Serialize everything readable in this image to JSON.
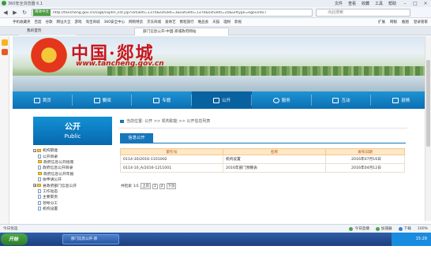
{
  "browser": {
    "window_title": "360安全浏览器 6.1",
    "menu": [
      "文件",
      "查看",
      "收藏",
      "工具",
      "帮助"
    ],
    "url_badge": "简体中文",
    "url": "http://tancheng.gov.cn/sxgk/sxjdm_list.jsp?sxfuletl=1370&sxfulet=3&sxfuletl=1370&sxfuletl=20&urltype=egovinfo.l",
    "search_placeholder": "点此搜索",
    "bookmarks": [
      "手机收藏夹",
      "百度",
      "谷歌",
      "网址大全",
      "游戏",
      "淘宝商城",
      "360安全中心",
      "网购特卖",
      "京东商城",
      "爱奇艺",
      "携程旅行",
      "唯品会",
      "天猫",
      "理财",
      "影视"
    ],
    "bookbar_right": [
      "扩展",
      "网银",
      "截图",
      "登录管家"
    ],
    "tabs": [
      "我的首页",
      "部门信息公开-中国·郯城政府网站"
    ]
  },
  "site": {
    "brand": "中国·郯城",
    "domain": "www.tancheng.gov.cn",
    "nav": [
      "首页",
      "要闻",
      "专题",
      "公开",
      "服务",
      "互动",
      "县情"
    ],
    "active_nav": 3
  },
  "sidebar": {
    "title": "公开",
    "subtitle": "Public",
    "tree": [
      {
        "label": "机构职能",
        "type": "folder",
        "pm": "-"
      },
      {
        "label": "公开目录",
        "type": "doc",
        "indent": 1
      },
      {
        "label": "政府信息公开指南",
        "type": "folder",
        "indent": 1,
        "pm": "+"
      },
      {
        "label": "政府信息公开目录",
        "type": "doc",
        "indent": 1
      },
      {
        "label": "政府信息公开年报",
        "type": "folder",
        "indent": 1,
        "pm": "+"
      },
      {
        "label": "依申请公开",
        "type": "doc",
        "indent": 1
      },
      {
        "label": "县政府部门信息公开",
        "type": "folder",
        "indent": 0,
        "pm": "+"
      },
      {
        "label": "工作动态",
        "type": "doc",
        "indent": 1
      },
      {
        "label": "主要职责",
        "type": "doc",
        "indent": 1
      },
      {
        "label": "领导分工",
        "type": "doc",
        "indent": 1
      },
      {
        "label": "机构设置",
        "type": "doc",
        "indent": 1
      }
    ]
  },
  "content": {
    "breadcrumb": "当前位置: 公开 >> 机构职能 >> 公开信息列表",
    "section_tab": "信息公开",
    "table": {
      "headers": [
        "索引号",
        "名称",
        "发布日期"
      ],
      "rows": [
        [
          "0114-30/2016-1101002",
          "机构设置",
          "2016年07月16日"
        ],
        [
          "0114-10_A/2016-1211001",
          "2016年部门预算表",
          "2016年04月12日"
        ]
      ]
    },
    "pager": {
      "prefix": "共检索",
      "pages": "1/1",
      "buttons": [
        "上页",
        "1",
        "2",
        "下页"
      ]
    }
  },
  "statusbar": {
    "left": "今日优选",
    "right": [
      "今日直播",
      "加速器",
      "下载",
      "100%"
    ]
  },
  "taskbar": {
    "start": "开始",
    "task": "部门信息公开-郯",
    "clock": "15:29"
  }
}
